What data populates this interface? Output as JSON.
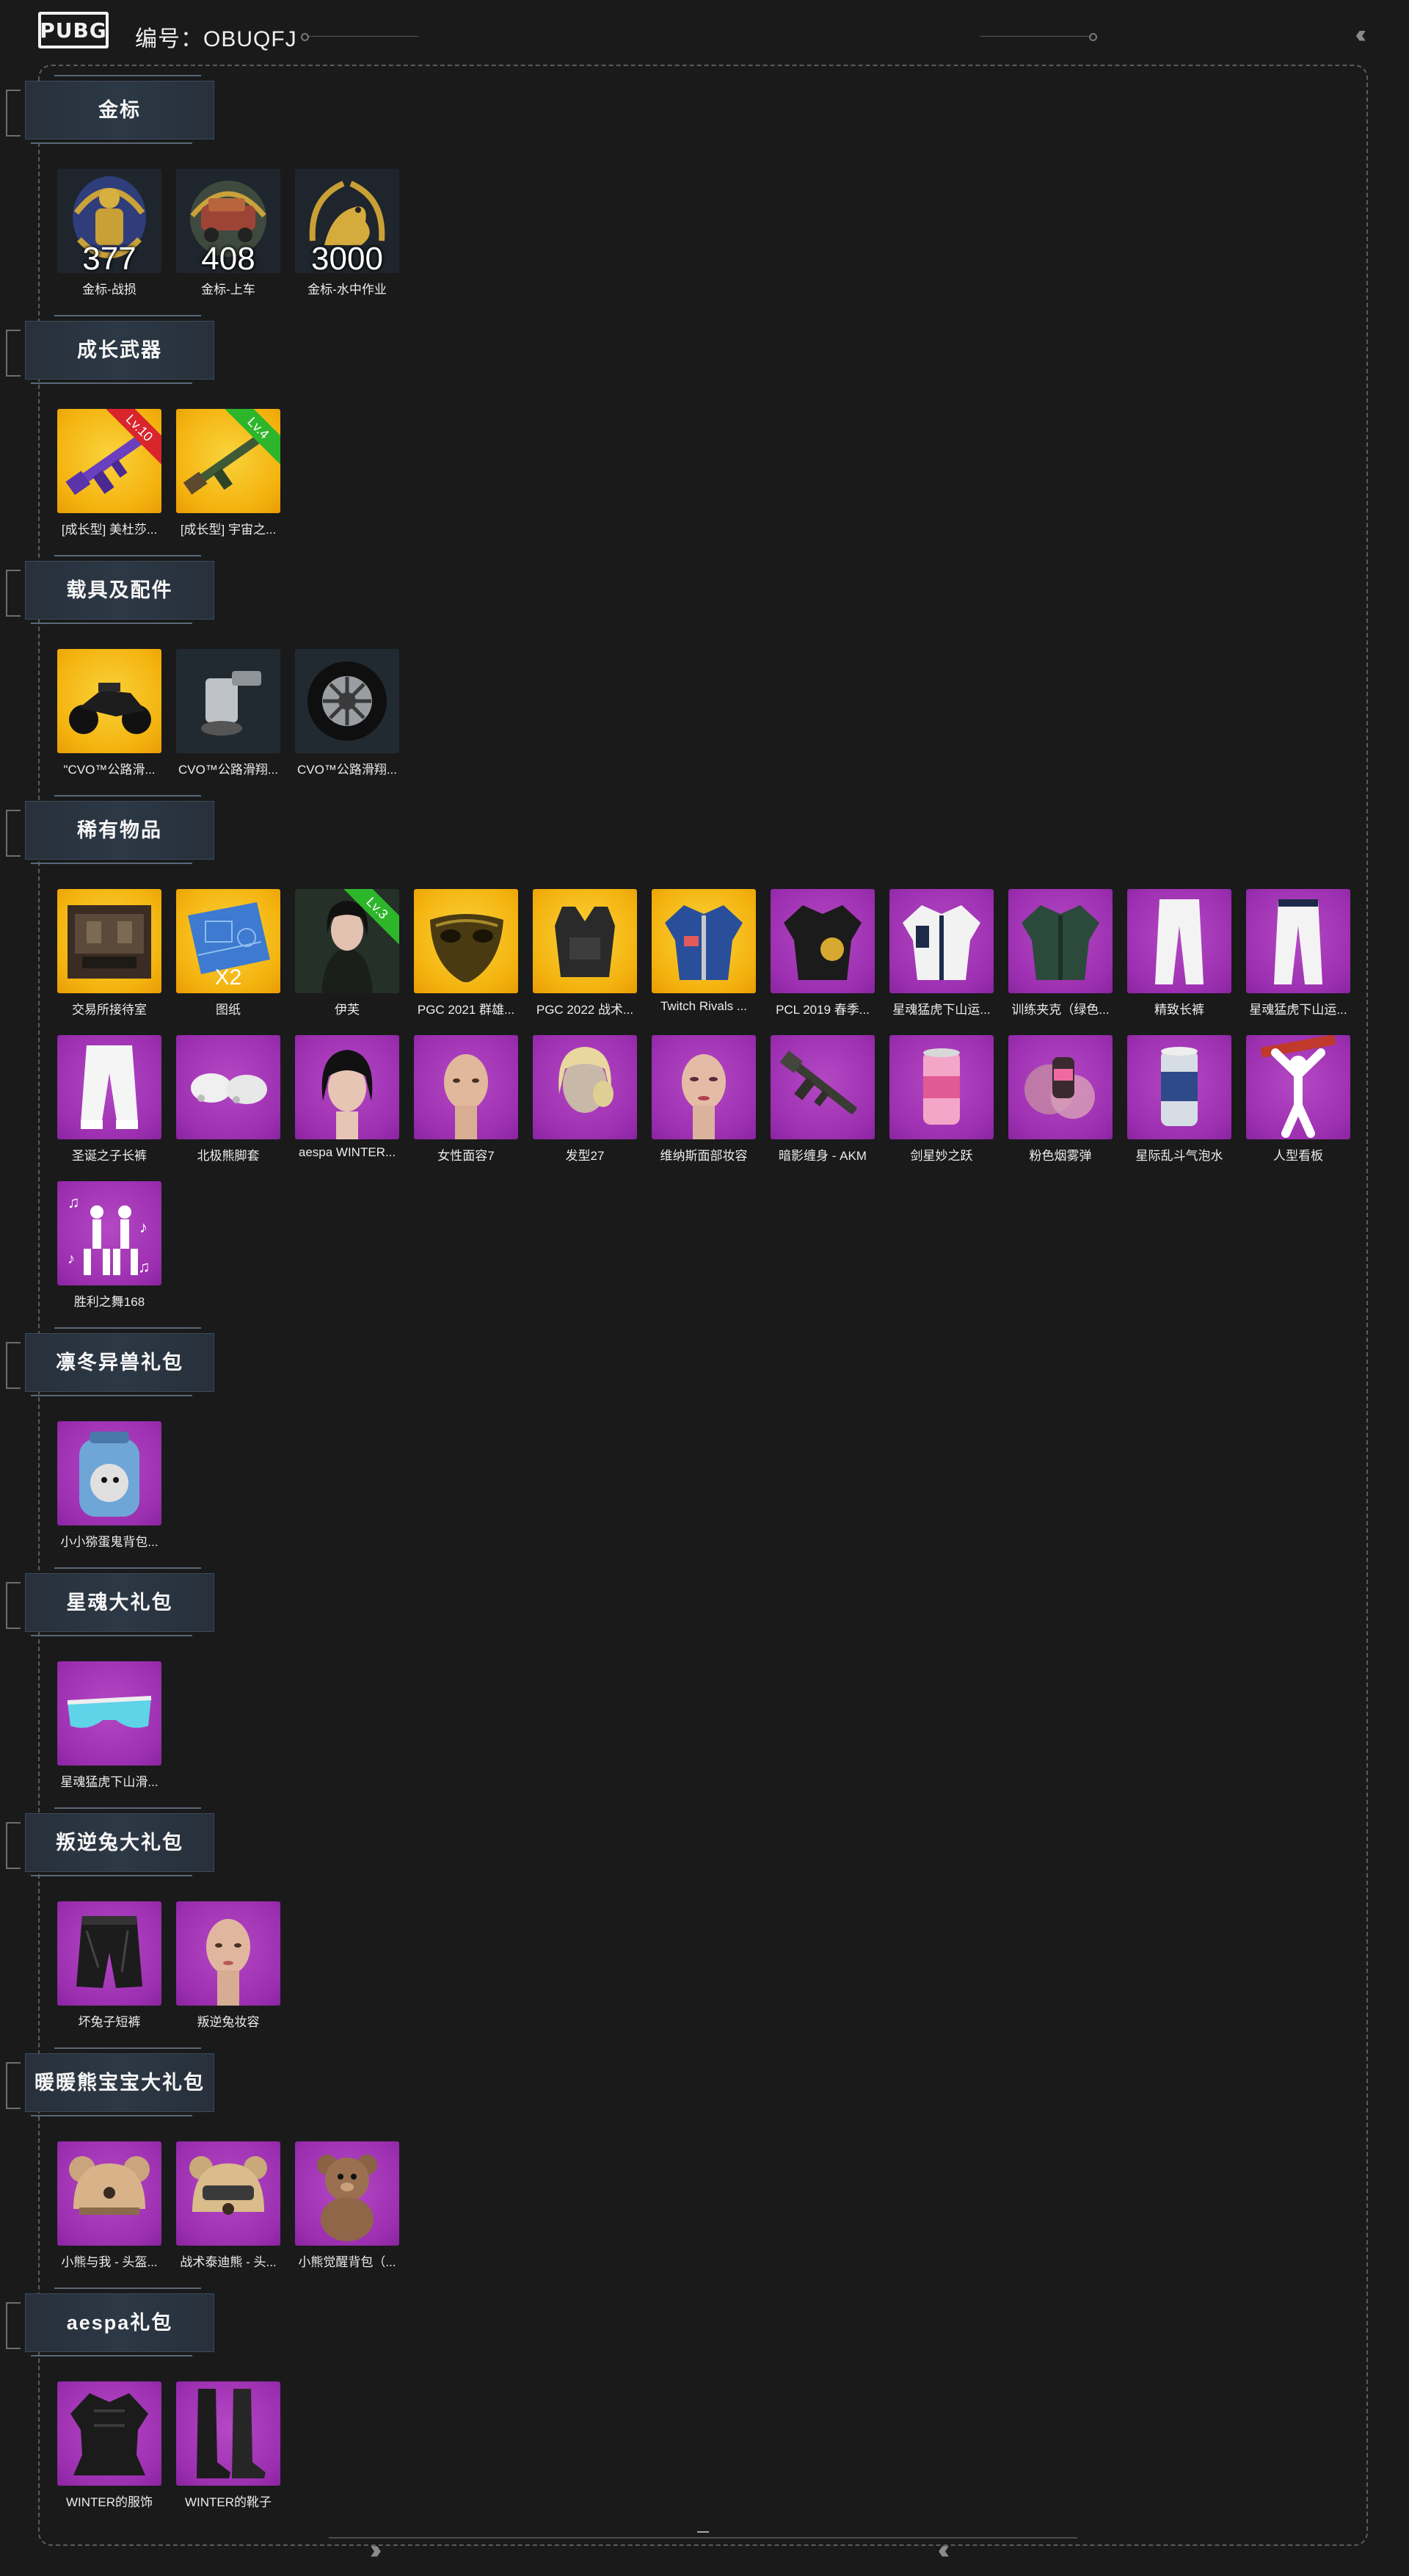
{
  "header": {
    "logo_text": "PUBG",
    "code_label": "编号：OBUQFJ"
  },
  "sections": [
    {
      "title": "金标",
      "items": [
        {
          "name": "金标-战损",
          "count": "377",
          "icon": "insignia-soldier-icon"
        },
        {
          "name": "金标-上车",
          "count": "408",
          "icon": "insignia-vehicle-icon"
        },
        {
          "name": "金标-水中作业",
          "count": "3000",
          "icon": "insignia-seal-icon"
        }
      ]
    },
    {
      "title": "成长武器",
      "items": [
        {
          "name": "[成长型] 美杜莎...",
          "level": "Lv.10",
          "icon": "rifle-purple-icon"
        },
        {
          "name": "[成长型] 宇宙之...",
          "level": "Lv.4",
          "icon": "rifle-green-icon"
        }
      ]
    },
    {
      "title": "载具及配件",
      "items": [
        {
          "name": "\"CVO™公路滑...",
          "icon": "motorcycle-icon"
        },
        {
          "name": "CVO™公路滑翔...",
          "icon": "engine-part-icon"
        },
        {
          "name": "CVO™公路滑翔...",
          "icon": "wheel-icon"
        }
      ]
    },
    {
      "title": "稀有物品",
      "items": [
        {
          "name": "交易所接待室",
          "icon": "room-icon"
        },
        {
          "name": "图纸",
          "extra": "X2",
          "icon": "blueprint-icon"
        },
        {
          "name": "伊芙",
          "level": "Lv.3",
          "icon": "character-eve-icon"
        },
        {
          "name": "PGC 2021 群雄...",
          "icon": "mask-icon"
        },
        {
          "name": "PGC 2022 战术...",
          "icon": "vest-icon"
        },
        {
          "name": "Twitch Rivals ...",
          "icon": "jacket-icon"
        },
        {
          "name": "PCL 2019 春季...",
          "icon": "jacket-black-icon"
        },
        {
          "name": "星魂猛虎下山运...",
          "icon": "jacket-white-icon"
        },
        {
          "name": "训练夹克（绿色...",
          "icon": "jacket-green-icon"
        },
        {
          "name": "精致长裤",
          "icon": "pants-white-icon"
        },
        {
          "name": "星魂猛虎下山运...",
          "icon": "pants-white-icon"
        },
        {
          "name": "圣诞之子长裤",
          "icon": "pants-white-icon"
        },
        {
          "name": "北极熊脚套",
          "icon": "paw-shoes-icon"
        },
        {
          "name": "aespa WINTER...",
          "icon": "hair-black-icon"
        },
        {
          "name": "女性面容7",
          "icon": "face-icon"
        },
        {
          "name": "发型27",
          "icon": "hair-blonde-icon"
        },
        {
          "name": "维纳斯面部妆容",
          "icon": "face-makeup-icon"
        },
        {
          "name": "暗影缠身 - AKM",
          "icon": "akm-icon"
        },
        {
          "name": "剑星妙之跃",
          "icon": "can-pink-icon"
        },
        {
          "name": "粉色烟雾弹",
          "icon": "smoke-grenade-icon"
        },
        {
          "name": "星际乱斗气泡水",
          "icon": "can-silver-icon"
        },
        {
          "name": "人型看板",
          "icon": "standee-icon"
        },
        {
          "name": "胜利之舞168",
          "icon": "dance-emote-icon"
        }
      ]
    },
    {
      "title": "凛冬异兽礼包",
      "items": [
        {
          "name": "小小猕蛋鬼背包...",
          "icon": "backpack-icon"
        }
      ]
    },
    {
      "title": "星魂大礼包",
      "items": [
        {
          "name": "星魂猛虎下山滑...",
          "icon": "goggles-icon"
        }
      ]
    },
    {
      "title": "叛逆兔大礼包",
      "items": [
        {
          "name": "坏兔子短裤",
          "icon": "shorts-icon"
        },
        {
          "name": "叛逆兔妆容",
          "icon": "face-icon"
        }
      ]
    },
    {
      "title": "暖暖熊宝宝大礼包",
      "items": [
        {
          "name": "小熊与我 - 头盔...",
          "icon": "bear-helmet-icon"
        },
        {
          "name": "战术泰迪熊 - 头...",
          "icon": "bear-helmet-tan-icon"
        },
        {
          "name": "小熊觉醒背包（...",
          "icon": "bear-backpack-icon"
        }
      ]
    },
    {
      "title": "aespa礼包",
      "items": [
        {
          "name": "WINTER的服饰",
          "icon": "outfit-black-icon"
        },
        {
          "name": "WINTER的靴子",
          "icon": "boots-icon"
        }
      ]
    }
  ],
  "colors": {
    "background": "#1a1a1b",
    "gold": "#f4b30f",
    "purple": "#9b2fb0",
    "ribbon_red": "#d9252c",
    "ribbon_green": "#2eb62a"
  }
}
